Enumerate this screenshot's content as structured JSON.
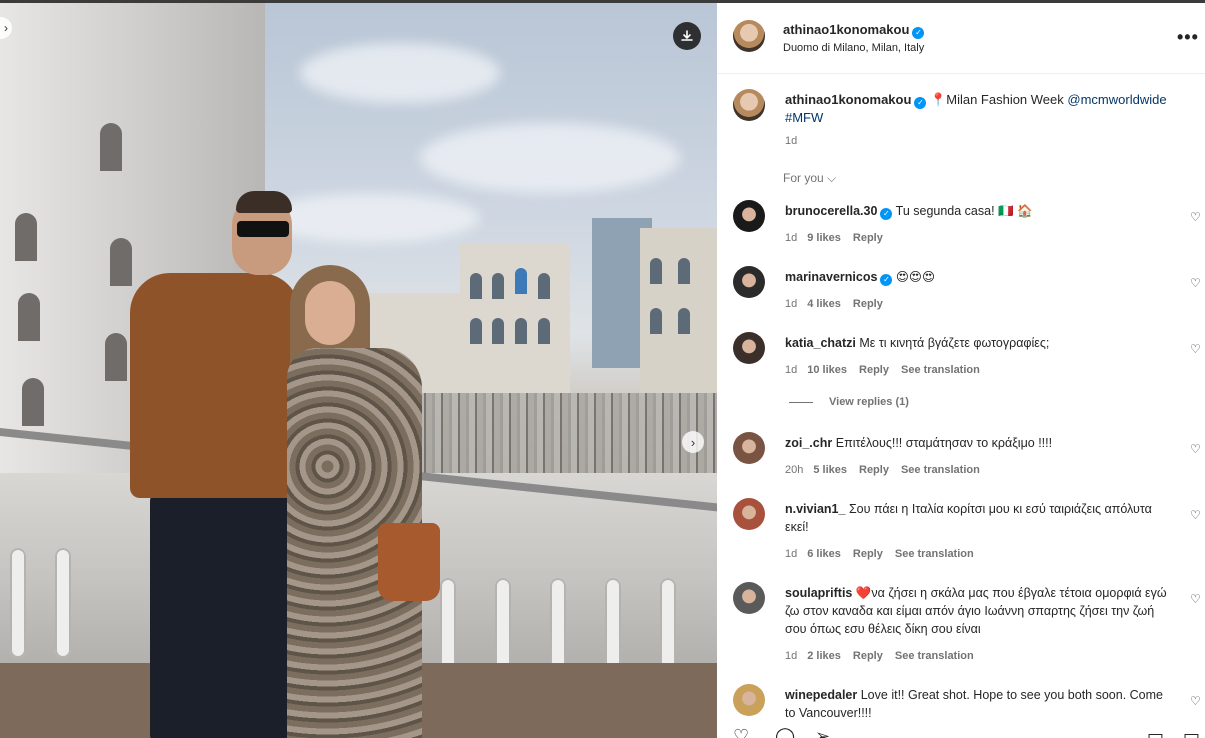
{
  "post": {
    "username": "athinao1konomakou",
    "location": "Duomo di Milano, Milan, Italy",
    "more_label": "•••",
    "caption_text": "Milan Fashion Week",
    "caption_mention": "@mcmworldwide",
    "caption_hashtag": "#MFW",
    "caption_time": "1d",
    "pin_icon": "📍",
    "for_you_label": "For you ⌵"
  },
  "photo": {
    "download_icon": "download-icon",
    "next_icon": "chevron-right-icon"
  },
  "comments": [
    {
      "user": "brunocerella.30",
      "verified": true,
      "text": "Tu segunda casa! 🇮🇹 🏠",
      "time": "1d",
      "likes": "9 likes",
      "reply": "Reply",
      "translation": "",
      "avatar_color": "#1a1a1a"
    },
    {
      "user": "marinavernicos",
      "verified": true,
      "text": "😍😍😍",
      "time": "1d",
      "likes": "4 likes",
      "reply": "Reply",
      "translation": "",
      "avatar_color": "#2b2b2b"
    },
    {
      "user": "katia_chatzi",
      "verified": false,
      "text": "Με τι κινητά βγάζετε φωτογραφίες;",
      "time": "1d",
      "likes": "10 likes",
      "reply": "Reply",
      "translation": "See translation",
      "avatar_color": "#3a2f2a"
    },
    {
      "user": "zoi_.chr",
      "verified": false,
      "text": "Επιτέλους!!! σταμάτησαν το κράξιμο !!!!",
      "time": "20h",
      "likes": "5 likes",
      "reply": "Reply",
      "translation": "See translation",
      "avatar_color": "#7a5443"
    },
    {
      "user": "n.vivian1_",
      "verified": false,
      "text": "Σου πάει η Ιταλία κορίτσι μου κι εσύ ταιριάζεις απόλυτα εκεί!",
      "time": "1d",
      "likes": "6 likes",
      "reply": "Reply",
      "translation": "See translation",
      "avatar_color": "#a8513d"
    },
    {
      "user": "soulapriftis",
      "verified": false,
      "text": "❤️να ζήσει η σκάλα μας που έβγαλε τέτοια ομορφιά εγώ ζω στον καναδα και είμαι απόν άγιο Ιωάννη σπαρτης ζήσει την ζωή σου όπως εσυ θέλεις δίκη σου είναι",
      "time": "1d",
      "likes": "2 likes",
      "reply": "Reply",
      "translation": "See translation",
      "avatar_color": "#5a5a5a"
    },
    {
      "user": "winepedaler",
      "verified": false,
      "text": "Love it!! Great shot. Hope to see you both soon. Come to Vancouver!!!!",
      "time": "",
      "likes": "",
      "reply": "",
      "translation": "",
      "avatar_color": "#c9a15a"
    }
  ],
  "view_replies": "View replies (1)",
  "heart_icon": "♡"
}
